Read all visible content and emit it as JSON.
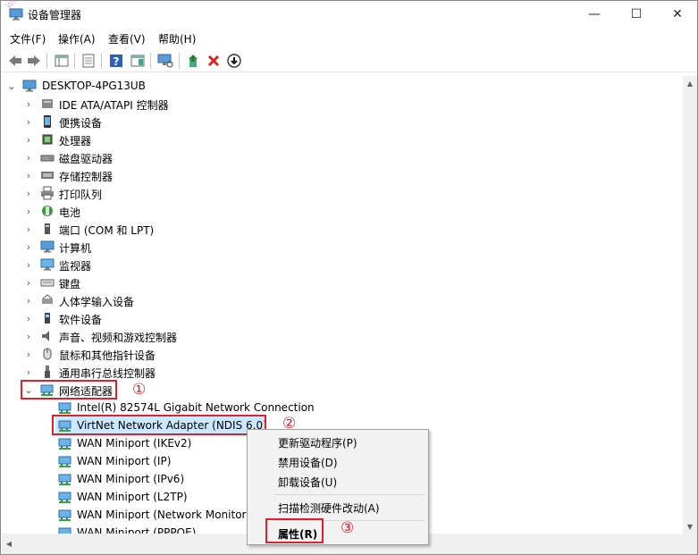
{
  "window": {
    "title": "设备管理器",
    "minimize": "—",
    "maximize": "☐",
    "close": "✕"
  },
  "watermark": "Win10之家",
  "menu": [
    "文件(F)",
    "操作(A)",
    "查看(V)",
    "帮助(H)"
  ],
  "tree": {
    "root": "DESKTOP-4PG13UB",
    "categories": [
      {
        "label": "IDE ATA/ATAPI 控制器",
        "icon": "ide-icon"
      },
      {
        "label": "便携设备",
        "icon": "portable-device-icon"
      },
      {
        "label": "处理器",
        "icon": "processor-icon"
      },
      {
        "label": "磁盘驱动器",
        "icon": "disk-drive-icon"
      },
      {
        "label": "存储控制器",
        "icon": "storage-controller-icon"
      },
      {
        "label": "打印队列",
        "icon": "printer-icon"
      },
      {
        "label": "电池",
        "icon": "battery-icon"
      },
      {
        "label": "端口 (COM 和 LPT)",
        "icon": "port-icon"
      },
      {
        "label": "计算机",
        "icon": "computer-icon"
      },
      {
        "label": "监视器",
        "icon": "monitor-icon"
      },
      {
        "label": "键盘",
        "icon": "keyboard-icon"
      },
      {
        "label": "人体学输入设备",
        "icon": "hid-icon"
      },
      {
        "label": "软件设备",
        "icon": "software-device-icon"
      },
      {
        "label": "声音、视频和游戏控制器",
        "icon": "sound-icon"
      },
      {
        "label": "鼠标和其他指针设备",
        "icon": "mouse-icon"
      },
      {
        "label": "通用串行总线控制器",
        "icon": "usb-icon"
      }
    ],
    "network": {
      "label": "网络适配器",
      "children": [
        "Intel(R) 82574L Gigabit Network Connection",
        "VirtNet Network Adapter (NDIS 6.0)",
        "WAN Miniport (IKEv2)",
        "WAN Miniport (IP)",
        "WAN Miniport (IPv6)",
        "WAN Miniport (L2TP)",
        "WAN Miniport (Network Monitor)",
        "WAN Miniport (PPPOE)"
      ]
    }
  },
  "annotations": {
    "step1": "①",
    "step2": "②",
    "step3": "③"
  },
  "context_menu": {
    "update_driver": "更新驱动程序(P)",
    "disable": "禁用设备(D)",
    "uninstall": "卸载设备(U)",
    "scan": "扫描检测硬件改动(A)",
    "properties": "属性(R)"
  },
  "colors": {
    "highlight_red": "#e0202a",
    "selection_blue": "#cce8ff"
  }
}
